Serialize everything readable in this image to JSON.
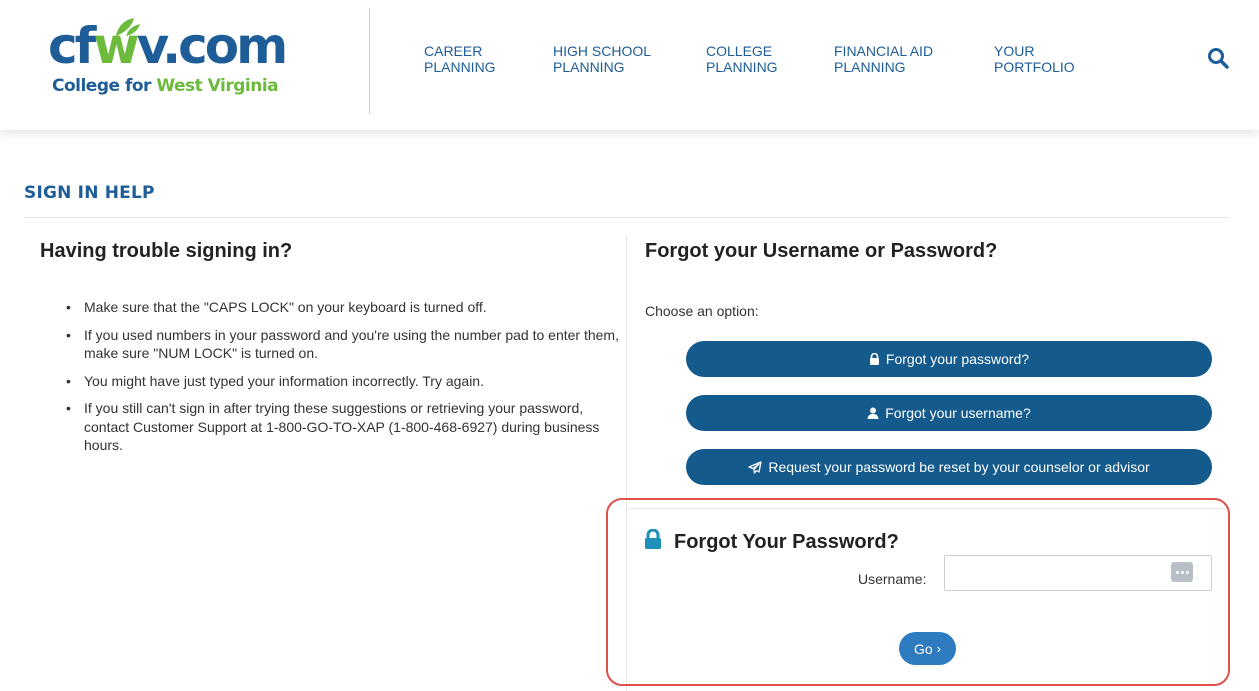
{
  "header": {
    "logo": {
      "main_text": "cfwv.com",
      "sub_text_1": "College for ",
      "sub_text_2": "West Virginia"
    },
    "nav": [
      {
        "line1": "CAREER",
        "line2": "PLANNING"
      },
      {
        "line1": "HIGH SCHOOL",
        "line2": "PLANNING"
      },
      {
        "line1": "COLLEGE",
        "line2": "PLANNING"
      },
      {
        "line1": "FINANCIAL AID",
        "line2": "PLANNING"
      },
      {
        "line1": "YOUR",
        "line2": "PORTFOLIO"
      }
    ],
    "search_icon": "search-icon"
  },
  "page": {
    "title": "SIGN IN HELP"
  },
  "left": {
    "heading": "Having trouble signing in?",
    "tips": [
      "Make sure that the \"CAPS LOCK\" on your keyboard is turned off.",
      "If you used numbers in your password and you're using the number pad to enter them, make sure \"NUM LOCK\" is turned on.",
      "You might have just typed your information incorrectly. Try again.",
      "If you still can't sign in after trying these suggestions or retrieving your password, contact Customer Support at 1-800-GO-TO-XAP (1-800-468-6927) during business hours."
    ]
  },
  "right": {
    "heading": "Forgot your Username or Password?",
    "choose_text": "Choose an option:",
    "options": [
      {
        "label": "Forgot your password?",
        "icon": "lock-icon"
      },
      {
        "label": "Forgot your username?",
        "icon": "user-icon"
      },
      {
        "label": "Request your password be reset by your counselor or advisor",
        "icon": "paper-plane-icon"
      }
    ]
  },
  "forgot_panel": {
    "title": "Forgot Your Password?",
    "username_label": "Username:",
    "username_value": "",
    "username_placeholder": "",
    "go_label": "Go",
    "highlight_color": "#e0514a"
  },
  "colors": {
    "brand_blue": "#1e5d98",
    "brand_green": "#6cbb3c",
    "button_blue": "#145a8c",
    "go_blue": "#2f7bbf",
    "lock_teal": "#1e8fb8"
  }
}
